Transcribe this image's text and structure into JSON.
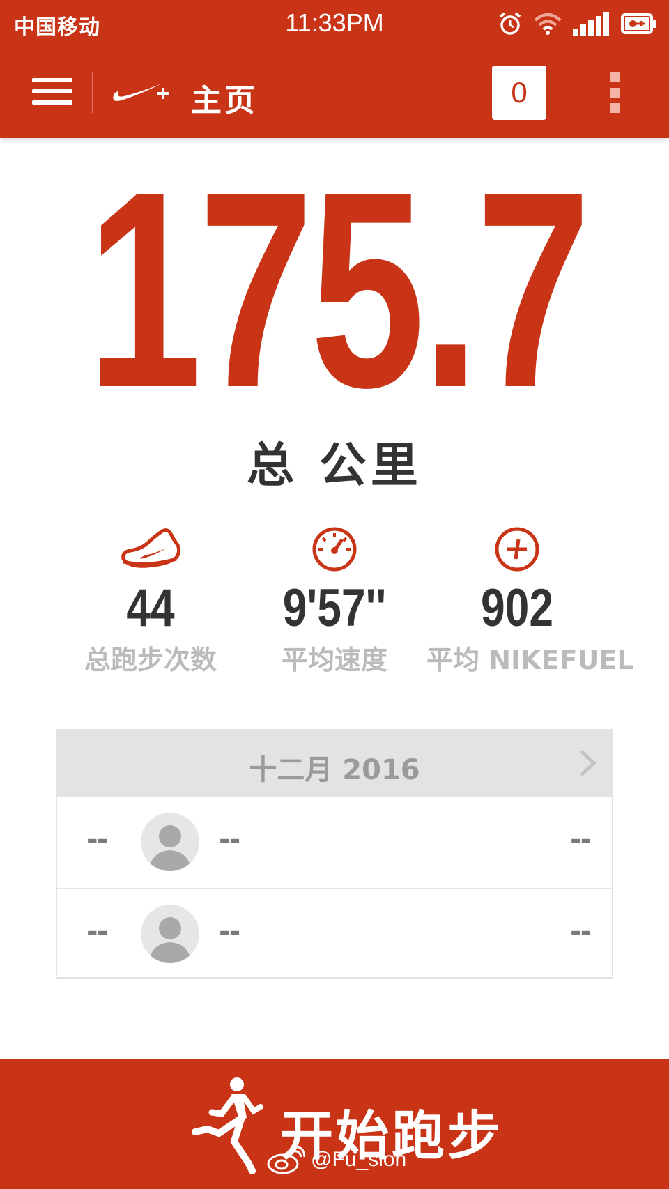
{
  "status_bar": {
    "carrier": "中国移动",
    "time": "11:33PM"
  },
  "app_bar": {
    "title": "主页",
    "notification_count": "0"
  },
  "summary": {
    "total_distance": "175.7",
    "total_unit": "总 公里"
  },
  "stats": [
    {
      "icon": "shoe-icon",
      "value": "44",
      "label": "总跑步次数"
    },
    {
      "icon": "speedometer-icon",
      "value": "9'57''",
      "label": "平均速度"
    },
    {
      "icon": "fuel-plus-icon",
      "value": "902",
      "label": "平均 NIKEFUEL"
    }
  ],
  "history": {
    "month": "十二月 2016",
    "rows": [
      {
        "left": "--",
        "middle": "--",
        "right": "--"
      },
      {
        "left": "--",
        "middle": "--",
        "right": "--"
      }
    ]
  },
  "start_button": {
    "label": "开始跑步"
  },
  "watermark": "@Fu_sion",
  "colors": {
    "accent": "#c93416",
    "text_dark": "#333333",
    "text_muted": "#bbbbbb",
    "panel_gray": "#e3e3e3"
  }
}
